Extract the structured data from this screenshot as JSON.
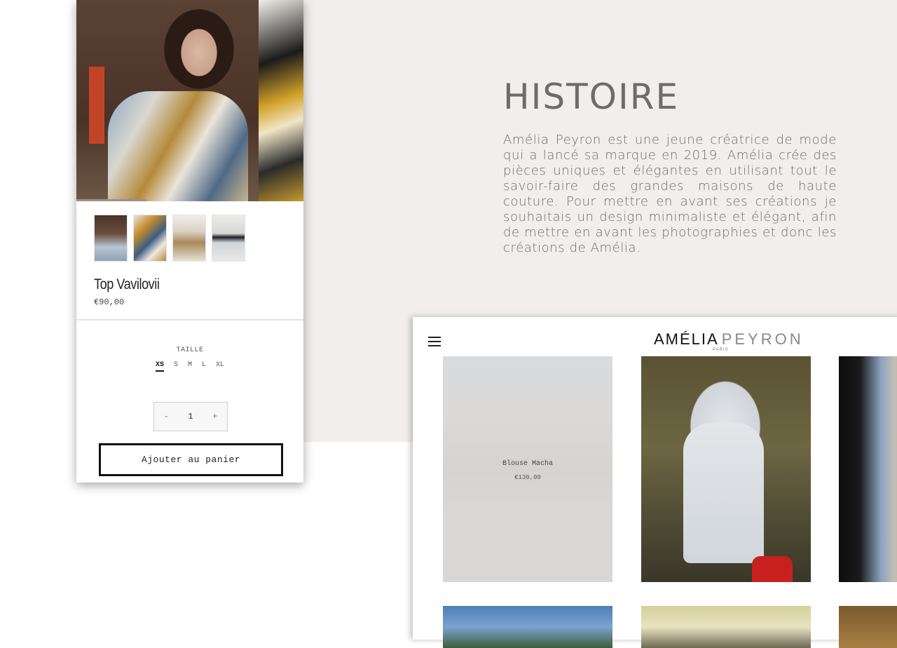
{
  "history": {
    "title": "HISTOIRE",
    "text": "Amélia Peyron est une jeune créatrice de mode qui a lancé sa marque en 2019. Amélia crée des pièces uniques et élégantes en utilisant tout le savoir-faire des grandes maisons de haute couture. Pour mettre en avant ses créations je souhaitais un design minimaliste et élégant, afin de mettre en avant les photographies et donc les créations de Amélia."
  },
  "product": {
    "name": "Top Vavilovii",
    "price": "€90,00",
    "size_label": "TAILLE",
    "sizes": [
      "XS",
      "S",
      "M",
      "L",
      "XL"
    ],
    "selected_size": "XS",
    "quantity": "1",
    "qty_minus": "-",
    "qty_plus": "+",
    "add_to_cart": "Ajouter au panier",
    "thumbnail_count": 4
  },
  "shop": {
    "logo_main": "AMÉLIA",
    "logo_secondary": "PEYRON",
    "logo_sub": "PARIS",
    "menu_icon": "hamburger-icon",
    "items": [
      {
        "name": "Blouse Macha",
        "price": "€130,00"
      }
    ]
  },
  "colors": {
    "background_panel": "#f1eeed",
    "title_text": "#6e6b6b",
    "button_border": "#111111"
  }
}
